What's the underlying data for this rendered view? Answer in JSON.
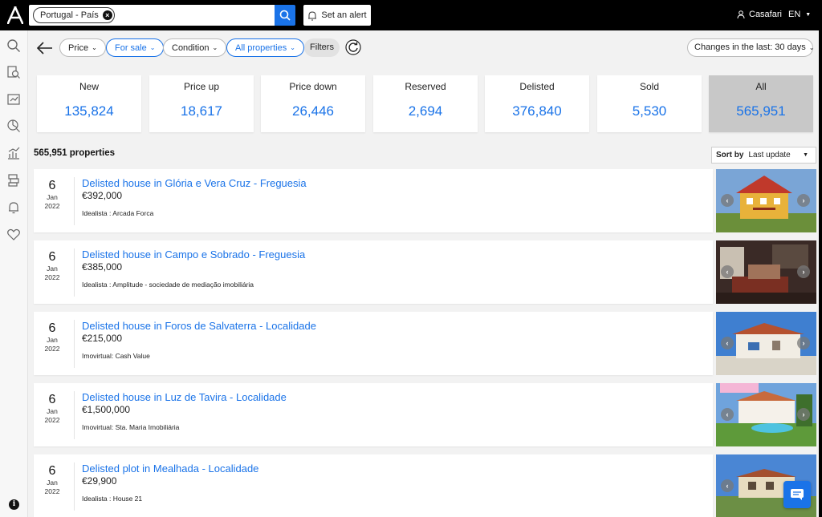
{
  "header": {
    "search_chip": "Portugal - País",
    "alert_label": "Set an alert",
    "user_label": "Casafari",
    "language": "EN"
  },
  "filters": {
    "price": "Price",
    "for_sale": "For sale",
    "condition": "Condition",
    "all_properties": "All properties",
    "filters_label": "Filters",
    "changes": "Changes in the last: 30 days"
  },
  "stats": [
    {
      "label": "New",
      "value": "135,824"
    },
    {
      "label": "Price up",
      "value": "18,617"
    },
    {
      "label": "Price down",
      "value": "26,446"
    },
    {
      "label": "Reserved",
      "value": "2,694"
    },
    {
      "label": "Delisted",
      "value": "376,840"
    },
    {
      "label": "Sold",
      "value": "5,530"
    },
    {
      "label": "All",
      "value": "565,951"
    }
  ],
  "results": {
    "count": "565,951 properties",
    "sort_label": "Sort by",
    "sort_value": "Last update"
  },
  "listings": [
    {
      "day": "6",
      "month": "Jan",
      "year": "2022",
      "title": "Delisted house in Glória e Vera Cruz - Freguesia",
      "price": "€392,000",
      "agency": "Idealista : Arcada Forca"
    },
    {
      "day": "6",
      "month": "Jan",
      "year": "2022",
      "title": "Delisted house in Campo e Sobrado - Freguesia",
      "price": "€385,000",
      "agency": "Idealista : Amplitude - sociedade de mediação imobiliária"
    },
    {
      "day": "6",
      "month": "Jan",
      "year": "2022",
      "title": "Delisted house in Foros de Salvaterra - Localidade",
      "price": "€215,000",
      "agency": "Imovirtual: Cash Value"
    },
    {
      "day": "6",
      "month": "Jan",
      "year": "2022",
      "title": "Delisted house in Luz de Tavira - Localidade",
      "price": "€1,500,000",
      "agency": "Imovirtual: Sta. Maria Imobiliária"
    },
    {
      "day": "6",
      "month": "Jan",
      "year": "2022",
      "title": "Delisted plot in Mealhada - Localidade",
      "price": "€29,900",
      "agency": "Idealista : House 21"
    }
  ],
  "colors": {
    "accent": "#1a73e8",
    "topbar": "#000000",
    "active_card": "#c8c8c8"
  },
  "icons": [
    "logo-icon",
    "search-icon",
    "bell-icon",
    "user-icon",
    "refresh-icon",
    "back-arrow-icon",
    "chat-icon",
    "info-icon"
  ]
}
